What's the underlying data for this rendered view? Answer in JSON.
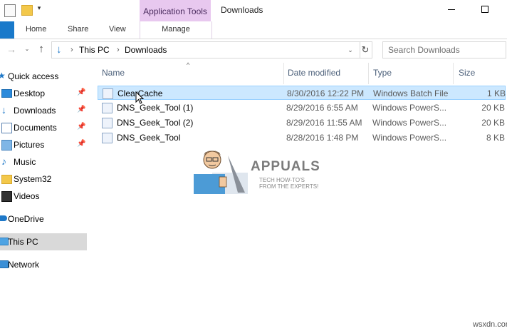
{
  "window": {
    "title": "Downloads",
    "context_tab": "Application Tools"
  },
  "ribbon": {
    "tabs": [
      "Home",
      "Share",
      "View",
      "Manage"
    ]
  },
  "address": {
    "crumbs": [
      "This PC",
      "Downloads"
    ],
    "search_placeholder": "Search Downloads"
  },
  "nav": {
    "quick_access": "Quick access",
    "items": [
      {
        "label": "Desktop",
        "icon": "desktop-icon",
        "pinned": true
      },
      {
        "label": "Downloads",
        "icon": "downloads-icon",
        "pinned": true
      },
      {
        "label": "Documents",
        "icon": "documents-icon",
        "pinned": true
      },
      {
        "label": "Pictures",
        "icon": "pictures-icon",
        "pinned": true
      },
      {
        "label": "Music",
        "icon": "music-icon",
        "pinned": false
      },
      {
        "label": "System32",
        "icon": "folder-icon",
        "pinned": false
      },
      {
        "label": "Videos",
        "icon": "videos-icon",
        "pinned": false
      }
    ],
    "onedrive": "OneDrive",
    "thispc": "This PC",
    "network": "Network"
  },
  "columns": {
    "name": "Name",
    "date": "Date modified",
    "type": "Type",
    "size": "Size"
  },
  "files": [
    {
      "name": "ClearCache",
      "date": "8/30/2016 12:22 PM",
      "type": "Windows Batch File",
      "size": "1 KB",
      "selected": true
    },
    {
      "name": "DNS_Geek_Tool (1)",
      "date": "8/29/2016 6:55 AM",
      "type": "Windows PowerS...",
      "size": "20 KB",
      "selected": false
    },
    {
      "name": "DNS_Geek_Tool (2)",
      "date": "8/29/2016 11:55 AM",
      "type": "Windows PowerS...",
      "size": "20 KB",
      "selected": false
    },
    {
      "name": "DNS_Geek_Tool",
      "date": "8/28/2016 1:48 PM",
      "type": "Windows PowerS...",
      "size": "8 KB",
      "selected": false
    }
  ],
  "watermark": {
    "brand": "APPUALS",
    "tagline": "TECH HOW-TO'S FROM THE EXPERTS!"
  },
  "site_mark": "wsxdn.com",
  "colors": {
    "accent": "#1979ca",
    "selection": "#cce8ff",
    "context_tab": "#e8c8ef"
  }
}
